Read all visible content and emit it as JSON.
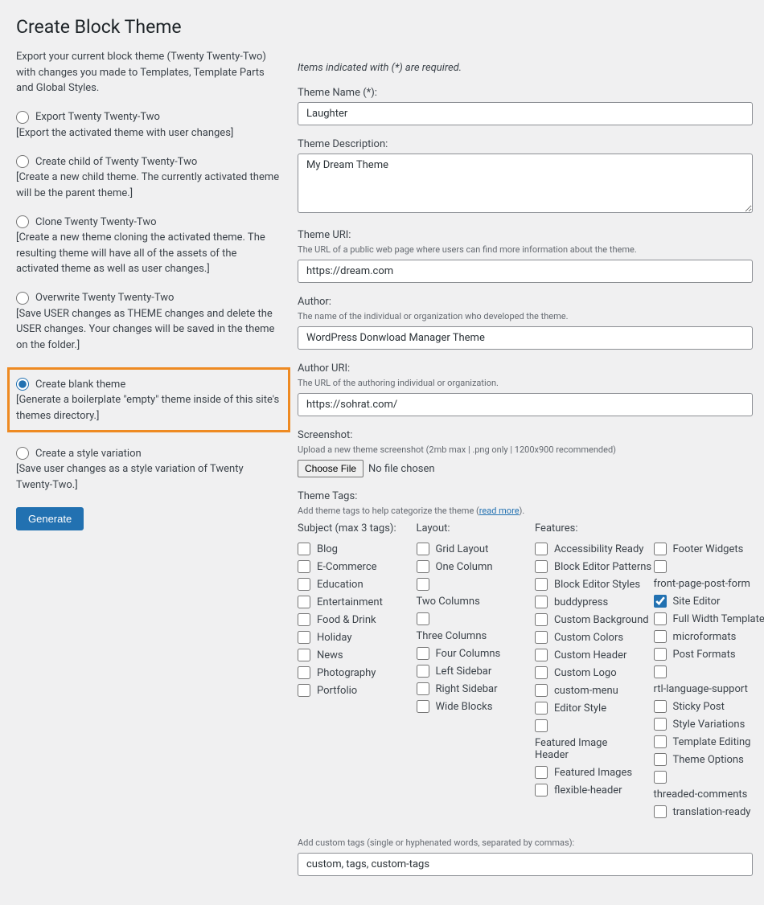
{
  "page_title": "Create Block Theme",
  "intro": "Export your current block theme (Twenty Twenty-Two) with changes you made to Templates, Template Parts and Global Styles.",
  "options": [
    {
      "label": "Export Twenty Twenty-Two",
      "desc": "[Export the activated theme with user changes]"
    },
    {
      "label": "Create child of Twenty Twenty-Two",
      "desc": "[Create a new child theme. The currently activated theme will be the parent theme.]"
    },
    {
      "label": "Clone Twenty Twenty-Two",
      "desc": "[Create a new theme cloning the activated theme. The resulting theme will have all of the assets of the activated theme as well as user changes.]"
    },
    {
      "label": "Overwrite Twenty Twenty-Two",
      "desc": "[Save USER changes as THEME changes and delete the USER changes. Your changes will be saved in the theme on the folder.]"
    },
    {
      "label": "Create blank theme",
      "desc": "[Generate a boilerplate \"empty\" theme inside of this site's themes directory.]"
    },
    {
      "label": "Create a style variation",
      "desc": "[Save user changes as a style variation of Twenty Twenty-Two.]"
    }
  ],
  "generate_label": "Generate",
  "required_note": "Items indicated with (*) are required.",
  "fields": {
    "theme_name": {
      "label": "Theme Name (*):",
      "value": "Laughter"
    },
    "theme_desc": {
      "label": "Theme Description:",
      "value": "My Dream Theme"
    },
    "theme_uri": {
      "label": "Theme URI:",
      "hint": "The URL of a public web page where users can find more information about the theme.",
      "value": "https://dream.com"
    },
    "author": {
      "label": "Author:",
      "hint": "The name of the individual or organization who developed the theme.",
      "value": "WordPress Donwload Manager Theme"
    },
    "author_uri": {
      "label": "Author URI:",
      "hint": "The URL of the authoring individual or organization.",
      "value": "https://sohrat.com/"
    },
    "screenshot": {
      "label": "Screenshot:",
      "hint": "Upload a new theme screenshot (2mb max | .png only | 1200x900 recommended)",
      "choose": "Choose File",
      "status": "No file chosen"
    },
    "tags_label": "Theme Tags:",
    "tags_hint_pre": "Add theme tags to help categorize the theme (",
    "tags_hint_link": "read more",
    "tags_hint_post": ").",
    "custom_tags": {
      "label": "Add custom tags (single or hyphenated words, separated by commas):",
      "value": "custom, tags, custom-tags"
    }
  },
  "tag_columns": {
    "subject": {
      "header": "Subject (max 3 tags):",
      "items": [
        "Blog",
        "E-Commerce",
        "Education",
        "Entertainment",
        "Food & Drink",
        "Holiday",
        "News",
        "Photography",
        "Portfolio"
      ]
    },
    "layout": {
      "header": "Layout:",
      "items": [
        "Grid Layout",
        "One Column",
        "Two Columns",
        "Three Columns",
        "Four Columns",
        "Left Sidebar",
        "Right Sidebar",
        "Wide Blocks"
      ]
    },
    "features": {
      "header": "Features:",
      "items": [
        "Accessibility Ready",
        "Block Editor Patterns",
        "Block Editor Styles",
        "buddypress",
        "Custom Background",
        "Custom Colors",
        "Custom Header",
        "Custom Logo",
        "custom-menu",
        "Editor Style",
        "Featured Image Header",
        "Featured Images",
        "flexible-header"
      ]
    },
    "features2": {
      "items": [
        "Footer Widgets",
        "front-page-post-form",
        "Site Editor",
        "Full Width Template",
        "microformats",
        "Post Formats",
        "rtl-language-support",
        "Sticky Post",
        "Style Variations",
        "Template Editing",
        "Theme Options",
        "threaded-comments",
        "translation-ready"
      ]
    }
  },
  "checked_features2": [
    "Site Editor"
  ],
  "wrapped_layout": [
    2,
    3
  ],
  "wrapped_features": [
    10
  ],
  "wrapped_features2": [
    1,
    6,
    11
  ]
}
